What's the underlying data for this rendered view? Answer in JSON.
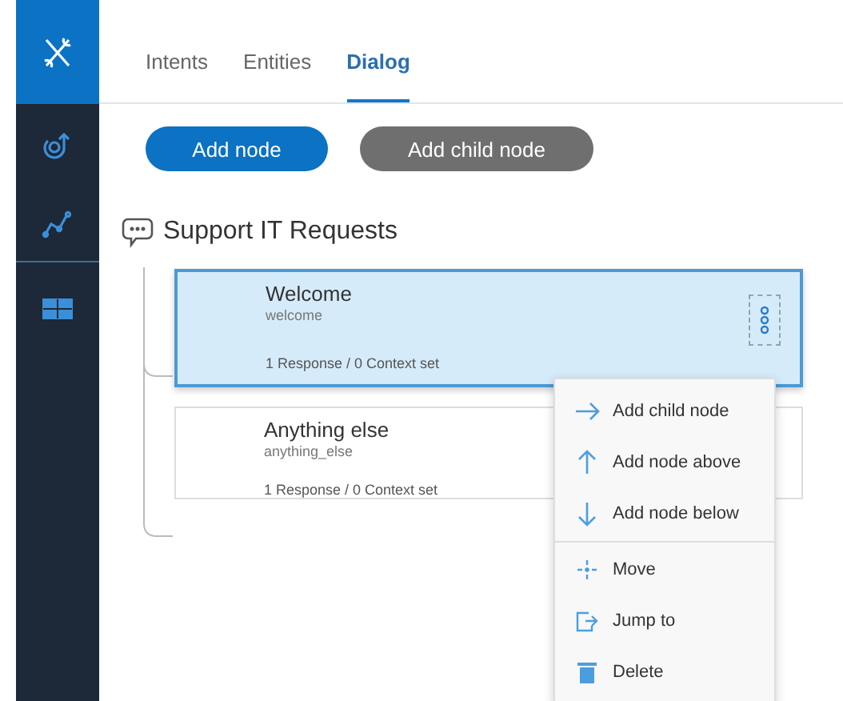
{
  "sidebar": {
    "items": [
      {
        "kind": "tools",
        "selected": true
      },
      {
        "kind": "loop",
        "selected": false
      },
      {
        "kind": "graph",
        "selected": false
      },
      {
        "kind": "table",
        "selected": false,
        "divider_before": true
      }
    ]
  },
  "tabs": [
    {
      "label": "Intents",
      "selected": false
    },
    {
      "label": "Entities",
      "selected": false
    },
    {
      "label": "Dialog",
      "selected": true
    }
  ],
  "buttons": [
    {
      "label": "Add node",
      "kind": "primary"
    },
    {
      "label": "Add child node",
      "kind": "secondary"
    }
  ],
  "tree": {
    "title": "Support IT Requests",
    "nodes": [
      {
        "title": "Welcome",
        "condition": "welcome",
        "summary": "1 Response / 0 Context set",
        "selected": true
      },
      {
        "title": "Anything else",
        "condition": "anything_else",
        "summary": "1 Response / 0 Context set",
        "selected": false
      }
    ]
  },
  "menu": {
    "groups": [
      [
        {
          "label": "Add child node",
          "kind": "arrow-right"
        },
        {
          "label": "Add node above",
          "kind": "arrow-up"
        },
        {
          "label": "Add node below",
          "kind": "arrow-down"
        }
      ],
      [
        {
          "label": "Move",
          "kind": "move"
        },
        {
          "label": "Jump to",
          "kind": "jump"
        },
        {
          "label": "Delete",
          "kind": "trash"
        }
      ]
    ]
  }
}
